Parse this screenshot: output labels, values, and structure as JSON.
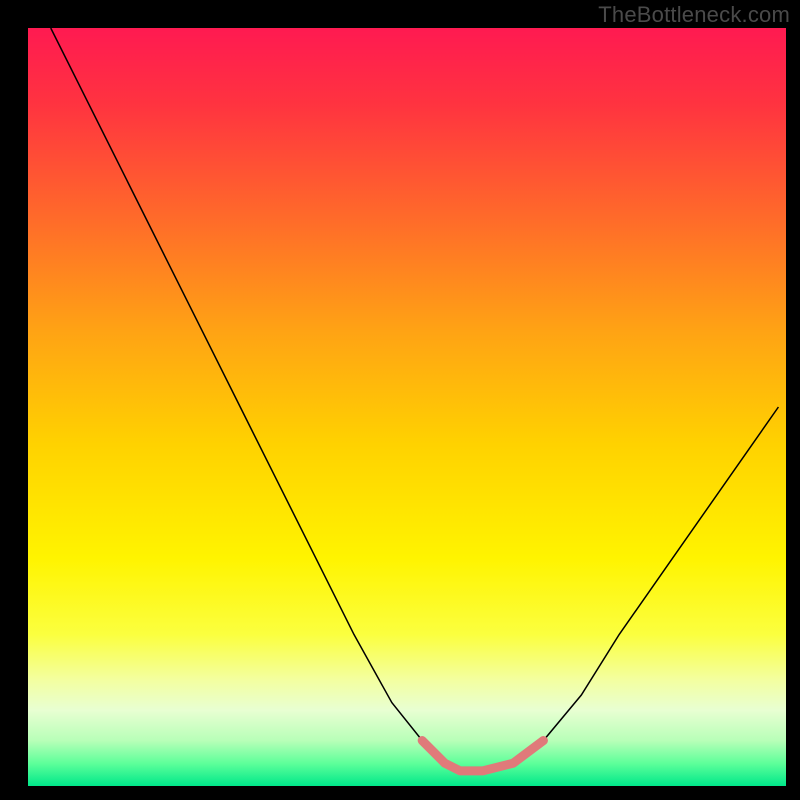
{
  "watermark": "TheBottleneck.com",
  "chart_data": {
    "type": "line",
    "title": "",
    "xlabel": "",
    "ylabel": "",
    "xlim": [
      0,
      100
    ],
    "ylim": [
      0,
      100
    ],
    "background_gradient": {
      "stops": [
        {
          "offset": 0.0,
          "color": "#ff1a51"
        },
        {
          "offset": 0.1,
          "color": "#ff3340"
        },
        {
          "offset": 0.25,
          "color": "#ff6a2a"
        },
        {
          "offset": 0.4,
          "color": "#ffa314"
        },
        {
          "offset": 0.55,
          "color": "#ffd200"
        },
        {
          "offset": 0.7,
          "color": "#fff400"
        },
        {
          "offset": 0.8,
          "color": "#fbff3f"
        },
        {
          "offset": 0.86,
          "color": "#f3ffa0"
        },
        {
          "offset": 0.9,
          "color": "#e8ffd2"
        },
        {
          "offset": 0.94,
          "color": "#b8ffb8"
        },
        {
          "offset": 0.97,
          "color": "#5eff9a"
        },
        {
          "offset": 1.0,
          "color": "#00e88a"
        }
      ]
    },
    "series": [
      {
        "name": "bottleneck-curve",
        "stroke": "#000000",
        "stroke_width": 1.5,
        "x": [
          3,
          8,
          13,
          18,
          23,
          28,
          33,
          38,
          43,
          48,
          52,
          55,
          57,
          60,
          64,
          68,
          73,
          78,
          85,
          92,
          99
        ],
        "y": [
          100,
          90,
          80,
          70,
          60,
          50,
          40,
          30,
          20,
          11,
          6,
          3,
          2,
          2,
          3,
          6,
          12,
          20,
          30,
          40,
          50
        ]
      },
      {
        "name": "sweet-spot",
        "stroke": "#e07a7a",
        "stroke_width": 9,
        "linecap": "round",
        "x": [
          52,
          55,
          57,
          60,
          64,
          68
        ],
        "y": [
          6,
          3,
          2,
          2,
          3,
          6
        ]
      }
    ]
  }
}
